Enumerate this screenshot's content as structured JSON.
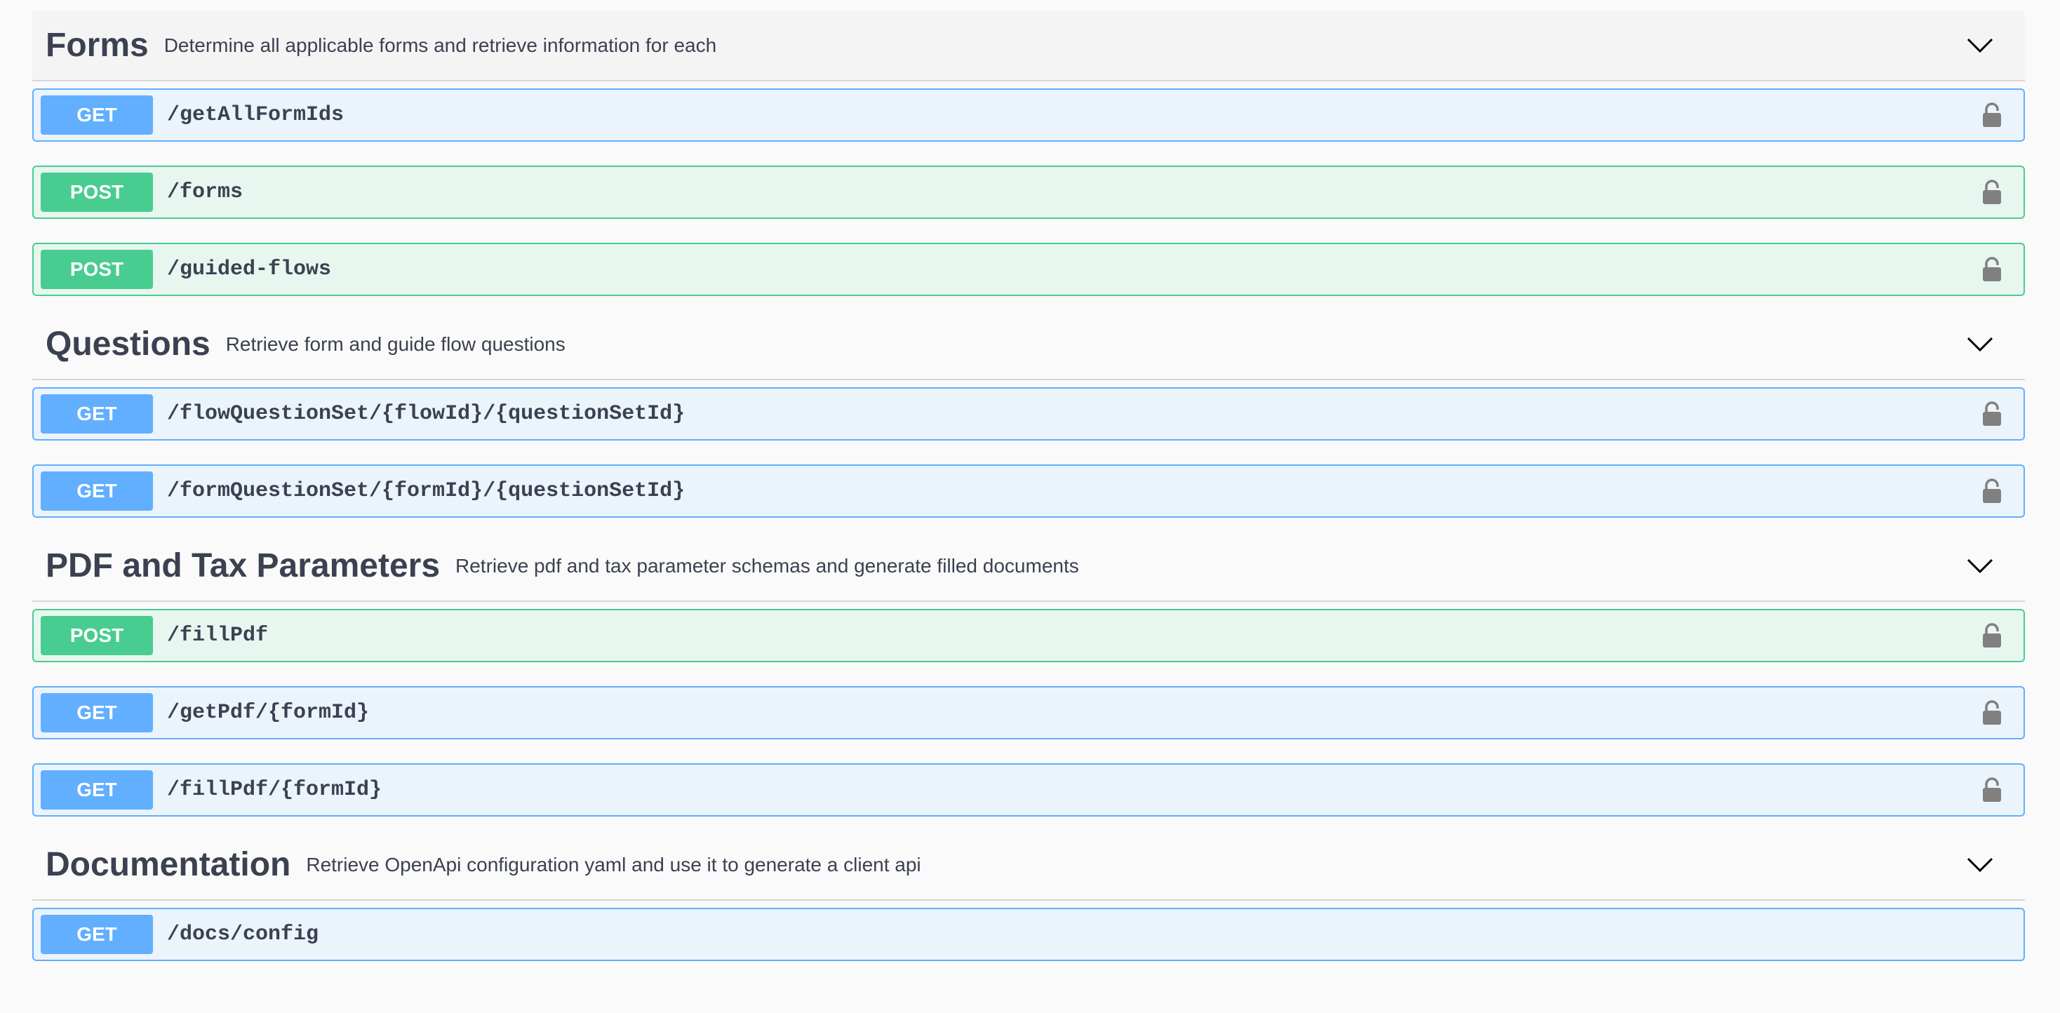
{
  "sections": [
    {
      "name": "Forms",
      "description": "Determine all applicable forms and retrieve information for each",
      "operations": [
        {
          "method": "GET",
          "path": "/getAllFormIds"
        },
        {
          "method": "POST",
          "path": "/forms"
        },
        {
          "method": "POST",
          "path": "/guided-flows"
        }
      ]
    },
    {
      "name": "Questions",
      "description": "Retrieve form and guide flow questions",
      "operations": [
        {
          "method": "GET",
          "path": "/flowQuestionSet/{flowId}/{questionSetId}"
        },
        {
          "method": "GET",
          "path": "/formQuestionSet/{formId}/{questionSetId}"
        }
      ]
    },
    {
      "name": "PDF and Tax Parameters",
      "description": "Retrieve pdf and tax parameter schemas and generate filled documents",
      "operations": [
        {
          "method": "POST",
          "path": "/fillPdf"
        },
        {
          "method": "GET",
          "path": "/getPdf/{formId}"
        },
        {
          "method": "GET",
          "path": "/fillPdf/{formId}"
        }
      ]
    },
    {
      "name": "Documentation",
      "description": "Retrieve OpenApi configuration yaml and use it to generate a client api",
      "operations": [
        {
          "method": "GET",
          "path": "/docs/config"
        }
      ]
    }
  ],
  "icons": {
    "expand": "chevron-down-icon",
    "auth": "lock-icon"
  },
  "colors": {
    "get": "#61affe",
    "post": "#49cc90",
    "get_bg": "#ebf3fb",
    "post_bg": "#e8f6f0",
    "text": "#3b4151"
  }
}
